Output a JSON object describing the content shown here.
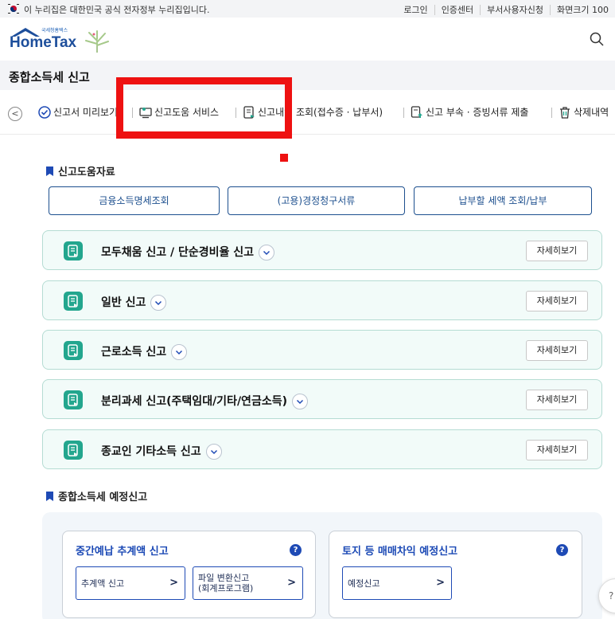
{
  "gov_bar": {
    "notice": "이 누리집은 대한민국 공식 전자정부 누리집입니다.",
    "links": [
      "로그인",
      "인증센터",
      "부서사용자신청",
      "화면크기 100"
    ]
  },
  "header": {
    "logo_small": "국세청홈택스",
    "logo_text": "HomeTax"
  },
  "page_title": "종합소득세 신고",
  "tabs": [
    {
      "label": "신고서 미리보기",
      "icon": "check-circle-icon"
    },
    {
      "label": "신고도움 서비스",
      "icon": "monitor-heart-icon"
    },
    {
      "label": "신고내역 조회(접수증 · 납부서)",
      "icon": "document-search-icon"
    },
    {
      "label": "신고 부속 · 증빙서류 제출",
      "icon": "document-upload-icon"
    },
    {
      "label": "삭제내역",
      "icon": "trash-icon"
    }
  ],
  "help_section": {
    "title": "신고도움자료",
    "buttons": [
      "금융소득명세조회",
      "(고용)경정청구서류",
      "납부할 세액 조회/납부"
    ]
  },
  "accordions": [
    {
      "label": "모두채움 신고 / 단순경비율 신고",
      "more": "자세히보기"
    },
    {
      "label": "일반 신고",
      "more": "자세히보기"
    },
    {
      "label": "근로소득 신고",
      "more": "자세히보기"
    },
    {
      "label": "분리과세 신고(주택임대/기타/연금소득)",
      "more": "자세히보기"
    },
    {
      "label": "종교인 기타소득 신고",
      "more": "자세히보기"
    }
  ],
  "prelim_section": {
    "title": "종합소득세 예정신고",
    "cards": [
      {
        "title": "중간예납 추계액 신고",
        "help": "?",
        "buttons": [
          {
            "line1": "추계액 신고",
            "line2": ""
          },
          {
            "line1": "파일 변환신고",
            "line2": "(회계프로그램)"
          }
        ]
      },
      {
        "title": "토지 등 매매차익 예정신고",
        "help": "?",
        "buttons": [
          {
            "line1": "예정신고",
            "line2": ""
          }
        ]
      }
    ]
  },
  "float_button": "?"
}
